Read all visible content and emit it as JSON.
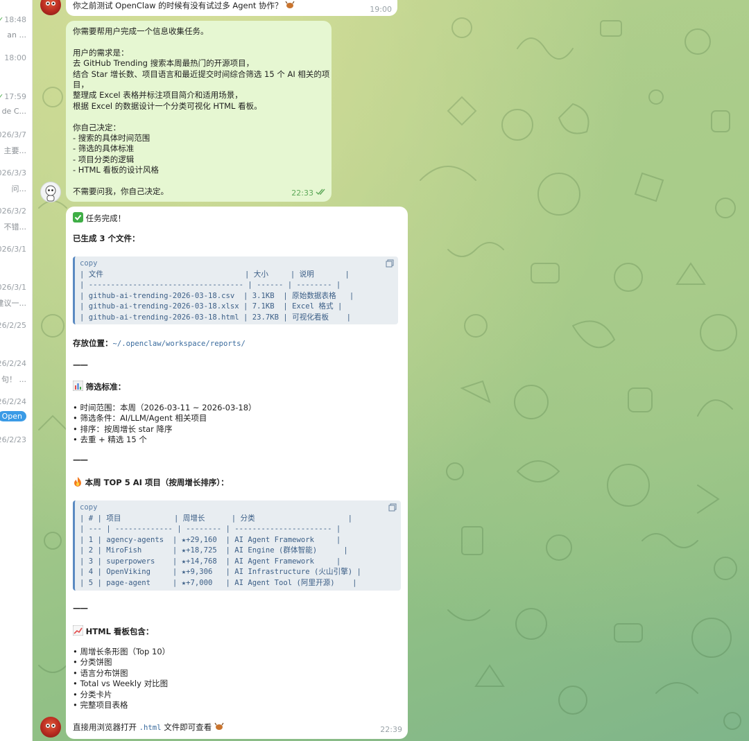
{
  "sidebar": {
    "items": [
      {
        "time": "18:48",
        "check": true,
        "sub": "an ..."
      },
      {
        "time": "18:00",
        "check": false,
        "sub": ""
      },
      {
        "time": "17:59",
        "check": true,
        "sub": "de C..."
      },
      {
        "time": "026/3/7",
        "check": false,
        "sub": "主要..."
      },
      {
        "time": "026/3/3",
        "check": false,
        "sub": "问..."
      },
      {
        "time": "026/3/2",
        "check": false,
        "sub": "不错..."
      },
      {
        "time": "026/3/1",
        "check": false,
        "sub": ""
      },
      {
        "time": "026/3/1",
        "check": false,
        "sub": "建议一..."
      },
      {
        "time": "26/2/25",
        "check": false,
        "sub": ""
      },
      {
        "time": "26/2/24",
        "check": false,
        "sub": "句！ ..."
      },
      {
        "time": "26/2/24",
        "check": false,
        "sub": "Open"
      },
      {
        "time": "26/2/23",
        "check": false,
        "sub": ""
      }
    ]
  },
  "messages": {
    "top": {
      "text": "你之前测试 OpenClaw 的时候有没有试过多 Agent 协作？",
      "time": "19:00"
    },
    "task": {
      "lines": [
        "你需要帮用户完成一个信息收集任务。",
        "",
        "用户的需求是：",
        "去 GitHub Trending 搜索本周最热门的开源项目，",
        "结合 Star 增长数、项目语言和最近提交时间综合筛选 15 个 AI 相关的项",
        "目，",
        "整理成 Excel 表格并标注项目简介和适用场景，",
        "根据 Excel 的数据设计一个分类可视化 HTML 看板。",
        "",
        "你自己决定：",
        "- 搜索的具体时间范围",
        "- 筛选的具体标准",
        "- 项目分类的逻辑",
        "- HTML 看板的设计风格",
        "",
        "不需要问我，你自己决定。"
      ],
      "time": "22:33"
    },
    "reply": {
      "done": "任务完成！",
      "files_heading": "已生成 3 个文件：",
      "copy_label": "copy",
      "files_table": [
        "| 文件                                | 大小     | 说明       |",
        "| ----------------------------------- | ------ | -------- |",
        "| github-ai-trending-2026-03-18.csv  | 3.1KB  | 原始数据表格   |",
        "| github-ai-trending-2026-03-18.xlsx | 7.1KB  | Excel 格式 |",
        "| github-ai-trending-2026-03-18.html | 23.7KB | 可视化看板    |"
      ],
      "location_label": "存放位置：",
      "location_path": "~/.openclaw/workspace/reports/",
      "rule": "——",
      "criteria_heading": "筛选标准：",
      "criteria": [
        "• 时间范围：本周（2026-03-11 ~ 2026-03-18）",
        "• 筛选条件：AI/LLM/Agent 相关项目",
        "• 排序：按周增长 star 降序",
        "• 去重 + 精选 15 个"
      ],
      "top5_heading": "本周 TOP 5 AI 项目（按周增长排序）：",
      "top5_table": [
        "| # | 项目            | 周增长      | 分类                     |",
        "| --- | ------------- | -------- | ---------------------- |",
        "| 1 | agency-agents  | ★+29,160  | AI Agent Framework     |",
        "| 2 | MiroFish       | ★+18,725  | AI Engine (群体智能)      |",
        "| 3 | superpowers    | ★+14,768  | AI Agent Framework     |",
        "| 4 | OpenViking     | ★+9,306   | AI Infrastructure (火山引擎) |",
        "| 5 | page-agent     | ★+7,000   | AI Agent Tool (阿里开源)    |"
      ],
      "dashboard_heading": "HTML 看板包含：",
      "dashboard": [
        "• 周增长条形图（Top 10）",
        "• 分类饼图",
        "• 语言分布饼图",
        "• Total vs Weekly 对比图",
        "• 分类卡片",
        "• 完整项目表格"
      ],
      "closing_prefix": "直接用浏览器打开",
      "closing_code": ".html",
      "closing_suffix": "文件即可查看",
      "time": "22:39"
    }
  }
}
